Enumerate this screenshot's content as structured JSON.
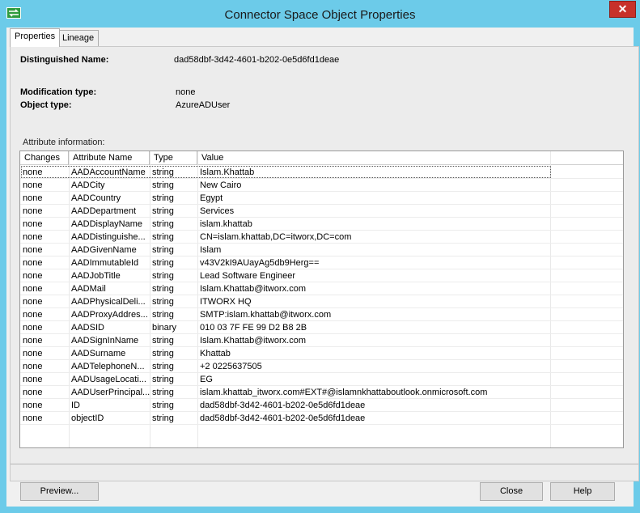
{
  "window": {
    "title": "Connector Space Object Properties",
    "close_label": "✕"
  },
  "tabs": [
    {
      "label": "Properties",
      "active": true
    },
    {
      "label": "Lineage",
      "active": false
    }
  ],
  "fields": {
    "distinguished_name_label": "Distinguished Name:",
    "distinguished_name_value": "dad58dbf-3d42-4601-b202-0e5d6fd1deae",
    "modification_type_label": "Modification type:",
    "modification_type_value": "none",
    "object_type_label": "Object type:",
    "object_type_value": "AzureADUser"
  },
  "attribute_section_label": "Attribute information:",
  "columns": [
    "Changes",
    "Attribute Name",
    "Type",
    "Value"
  ],
  "rows": [
    [
      "none",
      "AADAccountName",
      "string",
      "Islam.Khattab"
    ],
    [
      "none",
      "AADCity",
      "string",
      "New Cairo"
    ],
    [
      "none",
      "AADCountry",
      "string",
      "Egypt"
    ],
    [
      "none",
      "AADDepartment",
      "string",
      "Services"
    ],
    [
      "none",
      "AADDisplayName",
      "string",
      "islam.khattab"
    ],
    [
      "none",
      "AADDistinguishe...",
      "string",
      "CN=islam.khattab,DC=itworx,DC=com"
    ],
    [
      "none",
      "AADGivenName",
      "string",
      "Islam"
    ],
    [
      "none",
      "AADImmutableId",
      "string",
      "v43V2kI9AUayAg5db9Herg=="
    ],
    [
      "none",
      "AADJobTitle",
      "string",
      "Lead Software Engineer"
    ],
    [
      "none",
      "AADMail",
      "string",
      "Islam.Khattab@itworx.com"
    ],
    [
      "none",
      "AADPhysicalDeli...",
      "string",
      "ITWORX HQ"
    ],
    [
      "none",
      "AADProxyAddres...",
      "string",
      "SMTP:islam.khattab@itworx.com"
    ],
    [
      "none",
      "AADSID",
      "binary",
      "010 03 7F FE 99 D2 B8 2B"
    ],
    [
      "none",
      "AADSignInName",
      "string",
      "Islam.Khattab@itworx.com"
    ],
    [
      "none",
      "AADSurname",
      "string",
      "Khattab"
    ],
    [
      "none",
      "AADTelephoneN...",
      "string",
      "+2 0225637505"
    ],
    [
      "none",
      "AADUsageLocati...",
      "string",
      "EG"
    ],
    [
      "none",
      "AADUserPrincipal...",
      "string",
      "islam.khattab_itworx.com#EXT#@islamnkhattaboutlook.onmicrosoft.com"
    ],
    [
      "none",
      "ID",
      "string",
      "dad58dbf-3d42-4601-b202-0e5d6fd1deae"
    ],
    [
      "none",
      "objectID",
      "string",
      "dad58dbf-3d42-4601-b202-0e5d6fd1deae"
    ]
  ],
  "buttons": {
    "preview": "Preview...",
    "close": "Close",
    "help": "Help"
  }
}
